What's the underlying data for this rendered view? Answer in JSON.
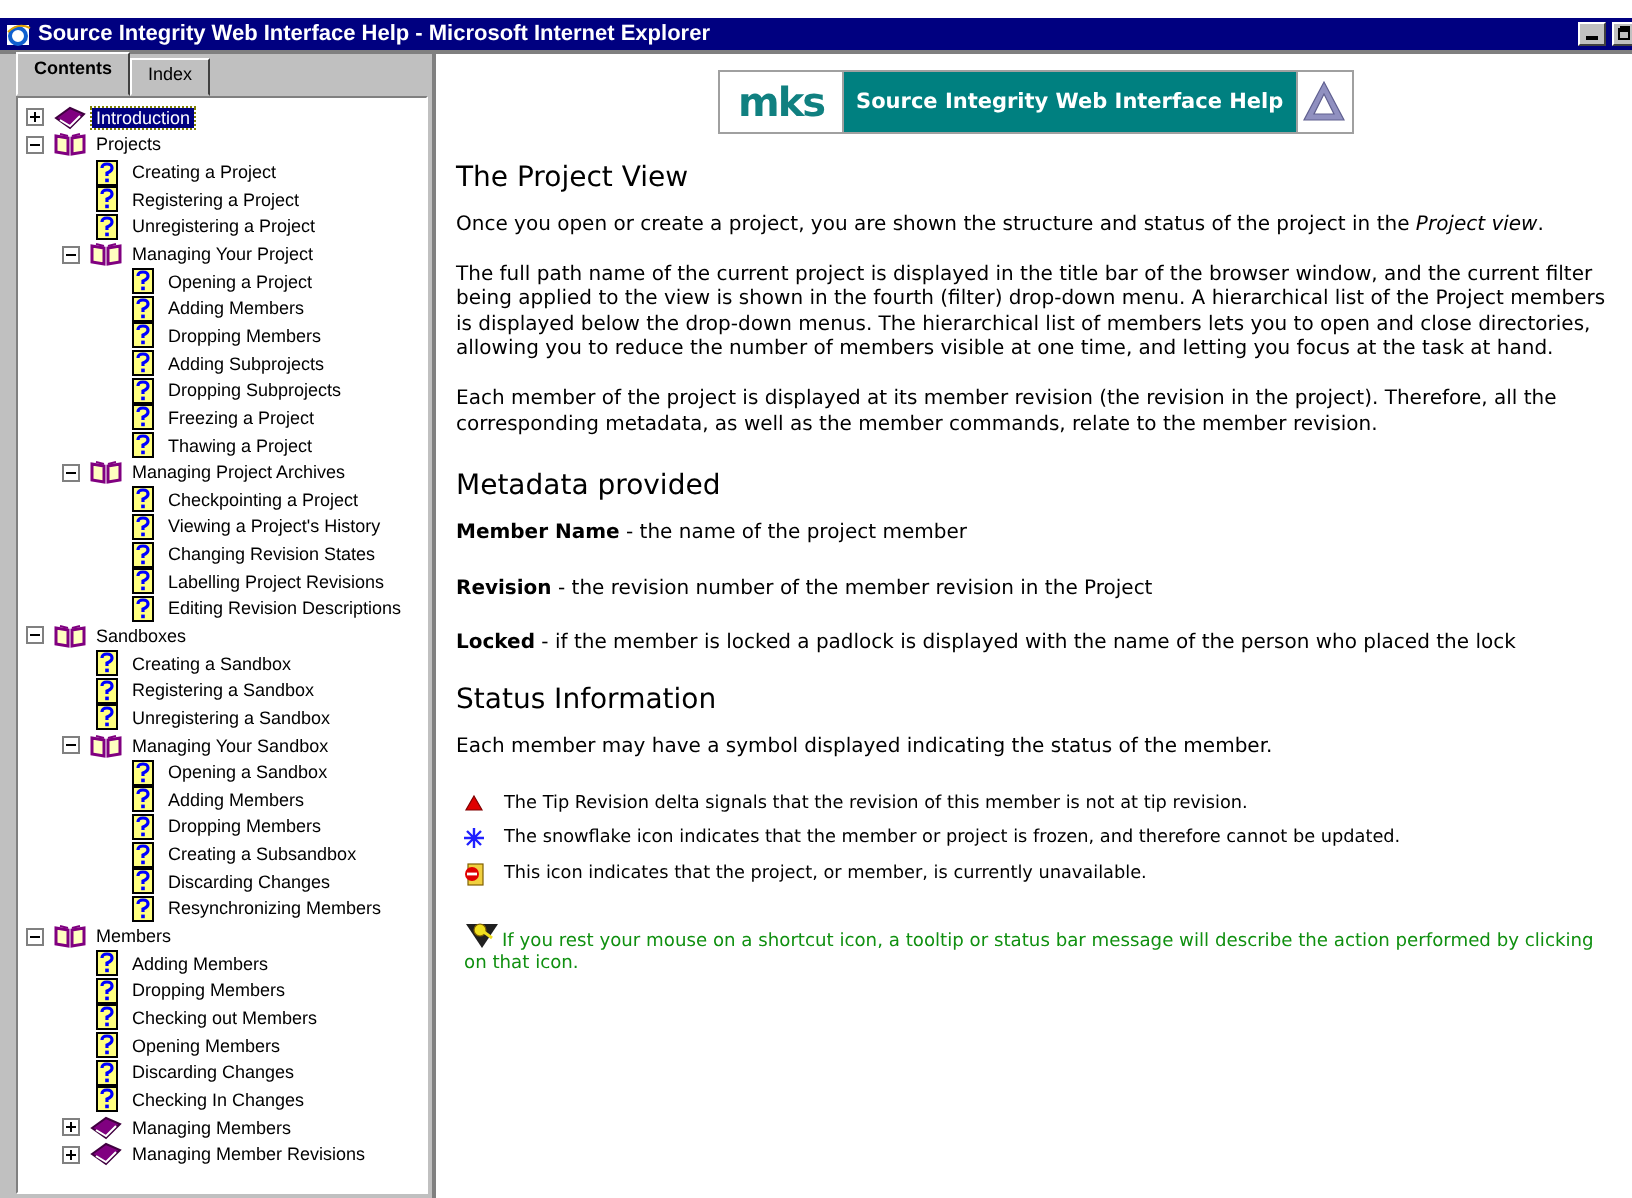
{
  "window": {
    "title": "Source Integrity Web Interface Help - Microsoft Internet Explorer"
  },
  "tabs": [
    {
      "label": "Contents",
      "selected": true
    },
    {
      "label": "Index",
      "selected": false
    }
  ],
  "tree": [
    {
      "kind": "book",
      "label": "Introduction",
      "expanded": false,
      "selected": true
    },
    {
      "kind": "book",
      "label": "Projects",
      "expanded": true,
      "selected": false,
      "children": [
        {
          "kind": "page",
          "label": "Creating a Project",
          "selected": false
        },
        {
          "kind": "page",
          "label": "Registering a Project",
          "selected": false
        },
        {
          "kind": "page",
          "label": "Unregistering a Project",
          "selected": false
        },
        {
          "kind": "book",
          "label": "Managing Your Project",
          "expanded": true,
          "selected": false,
          "children": [
            {
              "kind": "page",
              "label": "Opening a Project",
              "selected": false
            },
            {
              "kind": "page",
              "label": "Adding Members",
              "selected": false
            },
            {
              "kind": "page",
              "label": "Dropping Members",
              "selected": false
            },
            {
              "kind": "page",
              "label": "Adding Subprojects",
              "selected": false
            },
            {
              "kind": "page",
              "label": "Dropping Subprojects",
              "selected": false
            },
            {
              "kind": "page",
              "label": "Freezing a Project",
              "selected": false
            },
            {
              "kind": "page",
              "label": "Thawing a Project",
              "selected": false
            }
          ]
        },
        {
          "kind": "book",
          "label": "Managing Project Archives",
          "expanded": true,
          "selected": false,
          "children": [
            {
              "kind": "page",
              "label": "Checkpointing a Project",
              "selected": false
            },
            {
              "kind": "page",
              "label": "Viewing a Project's History",
              "selected": false
            },
            {
              "kind": "page",
              "label": "Changing Revision States",
              "selected": false
            },
            {
              "kind": "page",
              "label": "Labelling Project Revisions",
              "selected": false
            },
            {
              "kind": "page",
              "label": "Editing Revision Descriptions",
              "selected": false
            }
          ]
        }
      ]
    },
    {
      "kind": "book",
      "label": "Sandboxes",
      "expanded": true,
      "selected": false,
      "children": [
        {
          "kind": "page",
          "label": "Creating a Sandbox",
          "selected": false
        },
        {
          "kind": "page",
          "label": "Registering a Sandbox",
          "selected": false
        },
        {
          "kind": "page",
          "label": "Unregistering a Sandbox",
          "selected": false
        },
        {
          "kind": "book",
          "label": "Managing Your Sandbox",
          "expanded": true,
          "selected": false,
          "children": [
            {
              "kind": "page",
              "label": "Opening a Sandbox",
              "selected": false
            },
            {
              "kind": "page",
              "label": "Adding Members",
              "selected": false
            },
            {
              "kind": "page",
              "label": "Dropping Members",
              "selected": false
            },
            {
              "kind": "page",
              "label": "Creating a Subsandbox",
              "selected": false
            },
            {
              "kind": "page",
              "label": "Discarding Changes",
              "selected": false
            },
            {
              "kind": "page",
              "label": "Resynchronizing Members",
              "selected": false
            }
          ]
        }
      ]
    },
    {
      "kind": "book",
      "label": "Members",
      "expanded": true,
      "selected": false,
      "children": [
        {
          "kind": "page",
          "label": "Adding Members",
          "selected": false
        },
        {
          "kind": "page",
          "label": "Dropping Members",
          "selected": false
        },
        {
          "kind": "page",
          "label": "Checking out Members",
          "selected": false
        },
        {
          "kind": "page",
          "label": "Opening Members",
          "selected": false
        },
        {
          "kind": "page",
          "label": "Discarding Changes",
          "selected": false
        },
        {
          "kind": "page",
          "label": "Checking In Changes",
          "selected": false
        },
        {
          "kind": "book",
          "label": "Managing Members",
          "expanded": false,
          "selected": false
        },
        {
          "kind": "book",
          "label": "Managing Member Revisions",
          "expanded": false,
          "selected": false
        }
      ]
    }
  ],
  "banner": {
    "logo": "mks",
    "title": "Source Integrity Web Interface Help"
  },
  "topic": {
    "heading": "The Project View",
    "paragraphs": [
      "Once you open or create a project, you are shown the structure and status of the project in the *Project view*.",
      "The full path name of the current project is displayed in the title bar of the browser window, and the current filter being applied to the view is shown in the fourth (filter) drop-down menu. A hierarchical list of the Project members is displayed below the drop-down menus. The hierarchical list of members lets you to open and close directories, allowing you to reduce the number of members visible at one time, and letting you focus at the task at hand.",
      "Each member of the project is displayed at its member revision (the revision in the project). Therefore, all the corresponding metadata, as well as the member commands, relate to the member revision."
    ],
    "metadata_heading": "Metadata provided",
    "metadata": [
      "**Member Name** - the name of the project member",
      "**Revision** - the revision number of the member revision in the Project",
      "**Locked** - if the member is locked a padlock is displayed with the name of the person who placed the lock"
    ],
    "status_heading": "Status Information",
    "status_intro": "Each member may have a symbol displayed indicating the status of the member.",
    "status_items": [
      {
        "kind": "delta",
        "text": "The Tip Revision delta signals that the revision of this member is not at tip revision."
      },
      {
        "kind": "snowflake",
        "text": "The snowflake icon indicates that the member or project is frozen, and therefore cannot be updated."
      },
      {
        "kind": "unavailable",
        "text": "This icon indicates that the project, or member, is currently unavailable."
      }
    ],
    "tip": "If you rest your mouse on a shortcut icon, a tooltip or status bar message will describe the action performed by clicking on that icon."
  }
}
